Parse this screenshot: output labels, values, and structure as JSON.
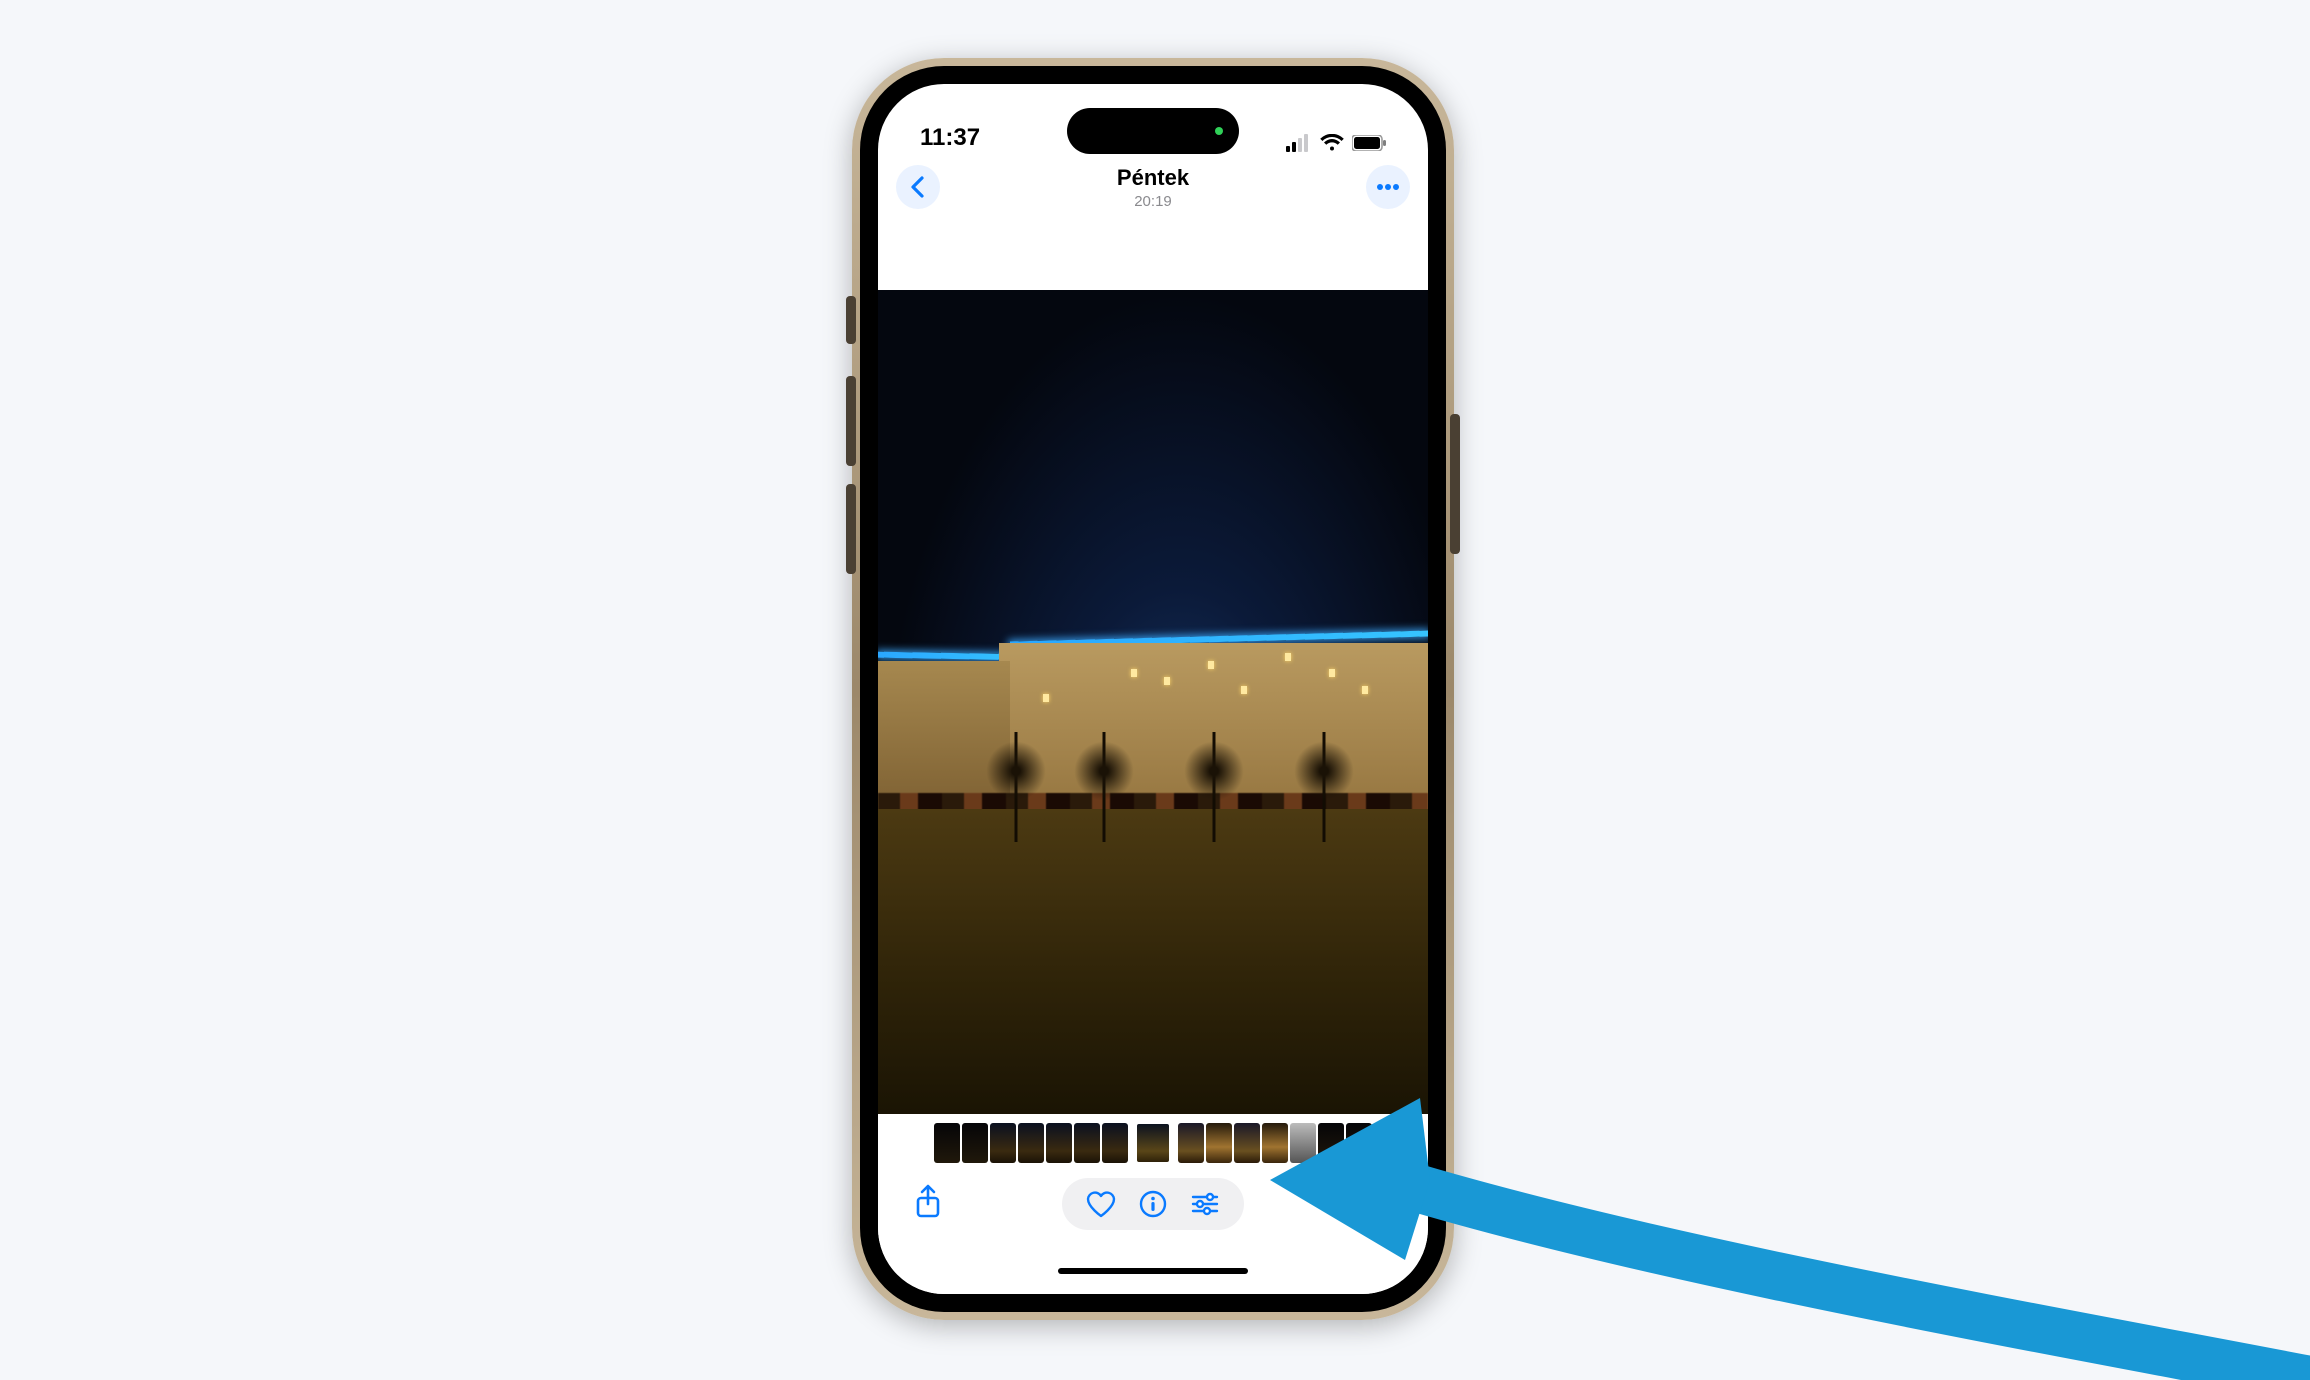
{
  "status": {
    "time": "11:37",
    "signal_icon": "cellular-signal-icon",
    "wifi_icon": "wifi-icon",
    "battery_icon": "battery-icon"
  },
  "nav": {
    "back_icon": "chevron-left-icon",
    "title": "Péntek",
    "subtitle": "20:19",
    "more_icon": "ellipsis-icon"
  },
  "photo": {
    "description": "Night photo of apartment buildings with blue roof lights, parked cars and bare trees in foreground"
  },
  "thumbnails": {
    "count": 15,
    "selected_index": 7
  },
  "toolbar": {
    "share_icon": "share-icon",
    "favorite_icon": "heart-icon",
    "info_icon": "info-circle-icon",
    "edit_icon": "sliders-icon"
  },
  "annotation": {
    "arrow_color": "#1998d5",
    "arrow_target": "edit-button"
  }
}
